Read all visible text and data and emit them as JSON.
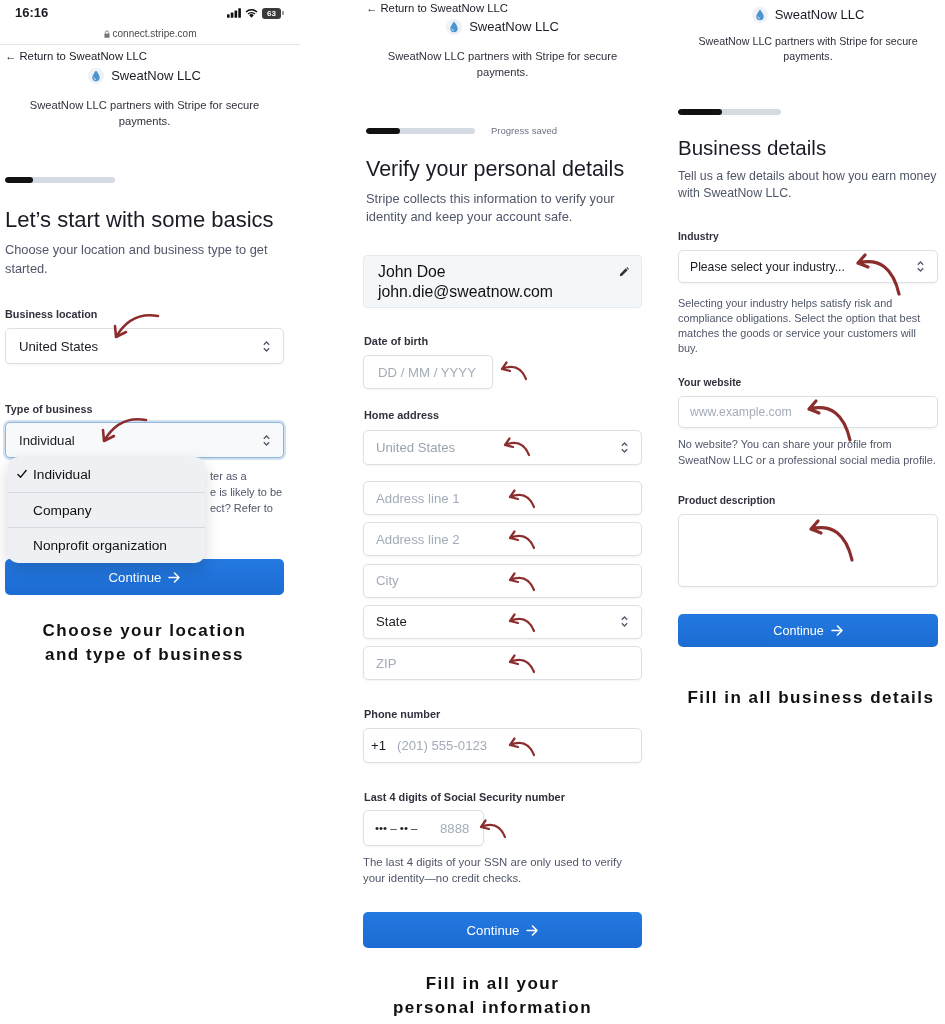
{
  "screens": [
    {
      "status_bar": {
        "time": "16:16",
        "battery": "63"
      },
      "url": "connect.stripe.com",
      "back_link": "← Return to SweatNow LLC",
      "brand": "SweatNow LLC",
      "partner_note": "SweatNow LLC partners with Stripe for secure payments.",
      "progress": {
        "level": 0.25
      },
      "heading": "Let’s start with some basics",
      "subtitle": "Choose your location and business type to get started.",
      "groups": [
        {
          "label": "Business location",
          "controls": [
            {
              "kind": "select",
              "value": "United States",
              "focused": false
            }
          ]
        },
        {
          "label": "Type of business",
          "controls": [
            {
              "kind": "select",
              "value": "Individual",
              "focused": true
            }
          ],
          "helper_fragments": [
            "ter as a",
            "e is likely to be",
            "ect? Refer to"
          ],
          "menu": [
            {
              "label": "Individual",
              "selected": true
            },
            {
              "label": "Company",
              "selected": false
            },
            {
              "label": "Nonprofit organization",
              "selected": false
            }
          ]
        }
      ],
      "button": "Continue",
      "caption": "Choose your location and type of business"
    },
    {
      "back_link": "← Return to SweatNow LLC",
      "brand": "SweatNow LLC",
      "partner_note": "SweatNow LLC partners with Stripe for secure payments.",
      "progress": {
        "level": 0.31,
        "note": "Progress saved"
      },
      "heading": "Verify your personal details",
      "subtitle": "Stripe collects this information to verify your identity and keep your account safe.",
      "identity": {
        "name": "John Doe",
        "email": "john.die@sweatnow.com"
      },
      "groups": [
        {
          "label": "Date of birth",
          "controls": [
            {
              "kind": "date",
              "placeholder": "DD / MM / YYYY",
              "focused": false
            }
          ]
        },
        {
          "label": "Home address",
          "controls": [
            {
              "kind": "select",
              "placeholder": "United States",
              "focused": false
            }
          ]
        },
        {
          "controls": [
            {
              "kind": "input",
              "placeholder": "Address line 1",
              "focused": false
            },
            {
              "kind": "input",
              "placeholder": "Address line 2",
              "focused": false
            },
            {
              "kind": "input",
              "placeholder": "City",
              "focused": false
            },
            {
              "kind": "select",
              "value": "State",
              "focused": false
            },
            {
              "kind": "input",
              "placeholder": "ZIP",
              "focused": false
            }
          ]
        },
        {
          "label": "Phone number",
          "controls": [
            {
              "kind": "phone",
              "prefix": "+1",
              "placeholder": "(201) 555-0123",
              "focused": false
            }
          ]
        },
        {
          "label": "Last 4 digits of Social Security number",
          "controls": [
            {
              "kind": "ssn",
              "prefix": "••• – •• –",
              "placeholder": "8888",
              "focused": false
            }
          ],
          "helper": "The last 4 digits of your SSN are only used to verify your identity—no credit checks."
        }
      ],
      "button": "Continue",
      "caption": "Fill in all your personal information"
    },
    {
      "brand": "SweatNow LLC",
      "partner_note": "SweatNow LLC partners with Stripe for secure payments.",
      "progress": {
        "level": 0.43
      },
      "heading": "Business details",
      "subtitle": "Tell us a few details about how you earn money with SweatNow LLC.",
      "groups": [
        {
          "label": "Industry",
          "controls": [
            {
              "kind": "select",
              "value": "Please select your industry...",
              "focused": false
            }
          ],
          "helper": "Selecting your industry helps satisfy risk and compliance obligations. Select the option that best matches the goods or service your customers will buy."
        },
        {
          "label": "Your website",
          "controls": [
            {
              "kind": "input",
              "placeholder": "www.example.com",
              "focused": false
            }
          ],
          "helper": "No website? You can share your profile from SweatNow LLC or a professional social media profile."
        },
        {
          "label": "Product description",
          "controls": [
            {
              "kind": "textarea",
              "focused": false
            }
          ]
        }
      ],
      "button": "Continue",
      "caption": "Fill in all business details"
    }
  ]
}
